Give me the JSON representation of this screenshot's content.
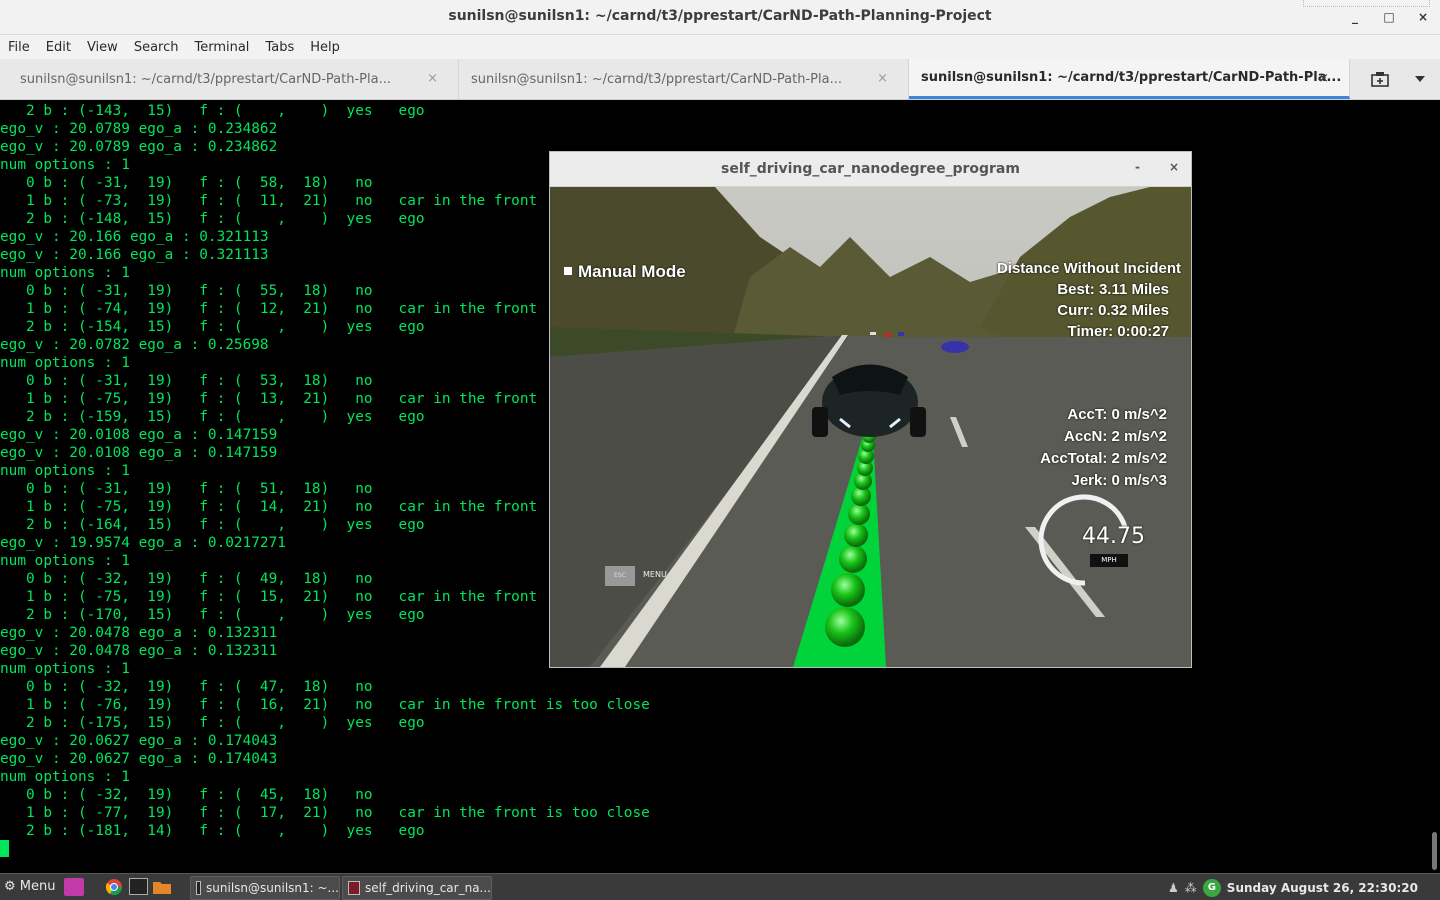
{
  "window": {
    "title": "sunilsn@sunilsn1: ~/carnd/t3/pprestart/CarND-Path-Planning-Project",
    "controls": [
      "_",
      "□",
      "×"
    ]
  },
  "menubar": [
    "File",
    "Edit",
    "View",
    "Search",
    "Terminal",
    "Tabs",
    "Help"
  ],
  "tabs": [
    {
      "label": "sunilsn@sunilsn1: ~/carnd/t3/pprestart/CarND-Path-Pla...",
      "close": "×"
    },
    {
      "label": "sunilsn@sunilsn1: ~/carnd/t3/pprestart/CarND-Path-Pla...",
      "close": "×"
    },
    {
      "label": "sunilsn@sunilsn1: ~/carnd/t3/pprestart/CarND-Path-Pla...",
      "close": "×",
      "active": true
    }
  ],
  "tab_actions": {
    "new_tab_icon": "new-tab-icon",
    "dropdown_icon": "chevron-down-icon"
  },
  "terminal": {
    "lines": [
      "   2 b : (-143,  15)   f : (    ,    )  yes   ego",
      "ego_v : 20.0789 ego_a : 0.234862",
      "ego_v : 20.0789 ego_a : 0.234862",
      "num options : 1",
      "   0 b : ( -31,  19)   f : (  58,  18)   no",
      "   1 b : ( -73,  19)   f : (  11,  21)   no   car in the front",
      "   2 b : (-148,  15)   f : (    ,    )  yes   ego",
      "ego_v : 20.166 ego_a : 0.321113",
      "ego_v : 20.166 ego_a : 0.321113",
      "num options : 1",
      "   0 b : ( -31,  19)   f : (  55,  18)   no",
      "   1 b : ( -74,  19)   f : (  12,  21)   no   car in the front",
      "   2 b : (-154,  15)   f : (    ,    )  yes   ego",
      "ego_v : 20.0782 ego_a : 0.25698",
      "num options : 1",
      "   0 b : ( -31,  19)   f : (  53,  18)   no",
      "   1 b : ( -75,  19)   f : (  13,  21)   no   car in the front",
      "   2 b : (-159,  15)   f : (    ,    )  yes   ego",
      "ego_v : 20.0108 ego_a : 0.147159",
      "ego_v : 20.0108 ego_a : 0.147159",
      "num options : 1",
      "   0 b : ( -31,  19)   f : (  51,  18)   no",
      "   1 b : ( -75,  19)   f : (  14,  21)   no   car in the front",
      "   2 b : (-164,  15)   f : (    ,    )  yes   ego",
      "ego_v : 19.9574 ego_a : 0.0217271",
      "num options : 1",
      "   0 b : ( -32,  19)   f : (  49,  18)   no",
      "   1 b : ( -75,  19)   f : (  15,  21)   no   car in the front",
      "   2 b : (-170,  15)   f : (    ,    )  yes   ego",
      "ego_v : 20.0478 ego_a : 0.132311",
      "ego_v : 20.0478 ego_a : 0.132311",
      "num options : 1",
      "   0 b : ( -32,  19)   f : (  47,  18)   no",
      "   1 b : ( -76,  19)   f : (  16,  21)   no   car in the front is too close",
      "   2 b : (-175,  15)   f : (    ,    )  yes   ego",
      "ego_v : 20.0627 ego_a : 0.174043",
      "ego_v : 20.0627 ego_a : 0.174043",
      "num options : 1",
      "   0 b : ( -32,  19)   f : (  45,  18)   no",
      "   1 b : ( -77,  19)   f : (  17,  21)   no   car in the front is too close",
      "   2 b : (-181,  14)   f : (    ,    )  yes   ego"
    ]
  },
  "simulator": {
    "title": "self_driving_car_nanodegree_program",
    "minimize": "-",
    "close": "×",
    "manual_mode": "Manual Mode",
    "distance_title": "Distance Without Incident",
    "best": "Best: 3.11 Miles",
    "curr": "Curr: 0.32 Miles",
    "timer": "Timer: 0:00:27",
    "acc_t": "AccT: 0 m/s^2",
    "acc_n": "AccN: 2 m/s^2",
    "acc_total": "AccTotal: 2 m/s^2",
    "jerk": "Jerk: 0 m/s^3",
    "speed": "44.75",
    "speed_unit": "MPH",
    "esc_label": "ESC",
    "menu_label": "MENU"
  },
  "taskbar": {
    "start_label": "Menu",
    "launchers": [
      "tray-app-icon",
      "chrome-icon",
      "terminal-icon",
      "folder-icon"
    ],
    "windows": [
      {
        "label": "sunilsn@sunilsn1: ~..."
      },
      {
        "label": "self_driving_car_na..."
      }
    ],
    "clock": "Sunday August 26, 22:30:20"
  }
}
